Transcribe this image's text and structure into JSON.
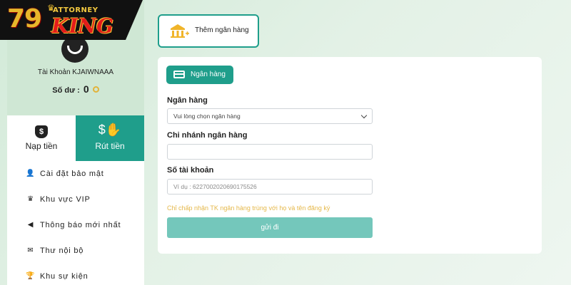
{
  "logo": {
    "number": "79",
    "top_word": "ATTORNEY",
    "brand": "KING"
  },
  "profile": {
    "account_label": "Tài Khoản KJAIWNAAA",
    "balance_label": "Số dư :",
    "balance_value": "0"
  },
  "tabs": [
    {
      "label": "Nạp tiền",
      "icon": "money-bag-icon",
      "active": false
    },
    {
      "label": "Rút tiền",
      "icon": "hand-coin-icon",
      "active": true
    }
  ],
  "menu": [
    {
      "label": "Cài đặt bảo mật",
      "icon": "user-lock-icon"
    },
    {
      "label": "Khu vực VIP",
      "icon": "vip-crown-icon"
    },
    {
      "label": "Thông báo mới nhất",
      "icon": "megaphone-icon"
    },
    {
      "label": "Thư nội bộ",
      "icon": "envelope-icon"
    },
    {
      "label": "Khu sự kiện",
      "icon": "trophy-icon"
    }
  ],
  "add_bank": {
    "label": "Thêm ngân hàng"
  },
  "form": {
    "pill_label": "Ngân hàng",
    "bank": {
      "label": "Ngân hàng",
      "selected": "Vui lòng chọn ngân hàng"
    },
    "branch": {
      "label": "Chi nhánh ngân hàng",
      "value": ""
    },
    "account_number": {
      "label": "Số tài khoản",
      "placeholder": "Ví dụ : 6227002020690175526"
    },
    "note": "Chỉ chấp nhận TK ngân hàng trùng với họ và tên đăng ký",
    "submit_label": "gửi đi"
  },
  "colors": {
    "accent": "#1f9e8b",
    "submit": "#74c7bb",
    "note": "#e5b84a",
    "logo_gold": "#e7b72b",
    "logo_red": "#e31b1b"
  }
}
